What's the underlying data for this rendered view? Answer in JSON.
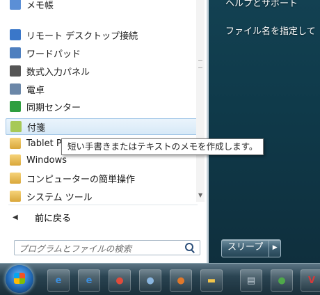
{
  "start_menu": {
    "items": [
      {
        "label": "メモ帳",
        "icon": "notepad-icon",
        "color": "#5b8fd6"
      },
      {
        "label": "リモート デスクトップ接続",
        "icon": "remote-desktop-icon",
        "color": "#3a77c9"
      },
      {
        "label": "ワードパッド",
        "icon": "wordpad-icon",
        "color": "#4e7fbf"
      },
      {
        "label": "数式入力パネル",
        "icon": "math-input-icon",
        "color": "#555555"
      },
      {
        "label": "電卓",
        "icon": "calculator-icon",
        "color": "#6b87a8"
      },
      {
        "label": "同期センター",
        "icon": "sync-center-icon",
        "color": "#2e9e3f"
      },
      {
        "label": "付箋",
        "icon": "sticky-notes-icon",
        "color": "#a7c957",
        "hover": true
      },
      {
        "label": "Tablet PC",
        "icon": "folder-icon"
      },
      {
        "label": "Windows",
        "icon": "folder-icon"
      },
      {
        "label": "コンピューターの簡単操作",
        "icon": "folder-icon"
      },
      {
        "label": "システム ツール",
        "icon": "folder-icon"
      }
    ],
    "back_label": "前に戻る",
    "search_placeholder": "プログラムとファイルの検索"
  },
  "tooltip": "短い手書きまたはテキストのメモを作成します。",
  "right_pane": {
    "help_label": "ヘルプとサポート",
    "file_label": "ファイル名を指定して"
  },
  "power": {
    "sleep_label": "スリープ"
  },
  "taskbar": {
    "apps": [
      {
        "icon": "ie-icon",
        "glyph": "e",
        "color": "#3b8fe0"
      },
      {
        "icon": "ie-icon-2",
        "glyph": "e",
        "color": "#3b8fe0"
      },
      {
        "icon": "chrome-icon",
        "glyph": "●",
        "color": "#e04b3b"
      },
      {
        "icon": "media-icon",
        "glyph": "●",
        "color": "#8ab6e0"
      },
      {
        "icon": "firefox-icon",
        "glyph": "●",
        "color": "#e0782b"
      },
      {
        "icon": "explorer-icon",
        "glyph": "▬",
        "color": "#f0c44a"
      },
      {
        "icon": "app-icon",
        "glyph": "▤",
        "color": "#c5d0d8"
      },
      {
        "icon": "globe-icon",
        "glyph": "●",
        "color": "#4fa84a"
      },
      {
        "icon": "v-app-icon",
        "glyph": "V",
        "color": "#d43a3a"
      }
    ]
  }
}
